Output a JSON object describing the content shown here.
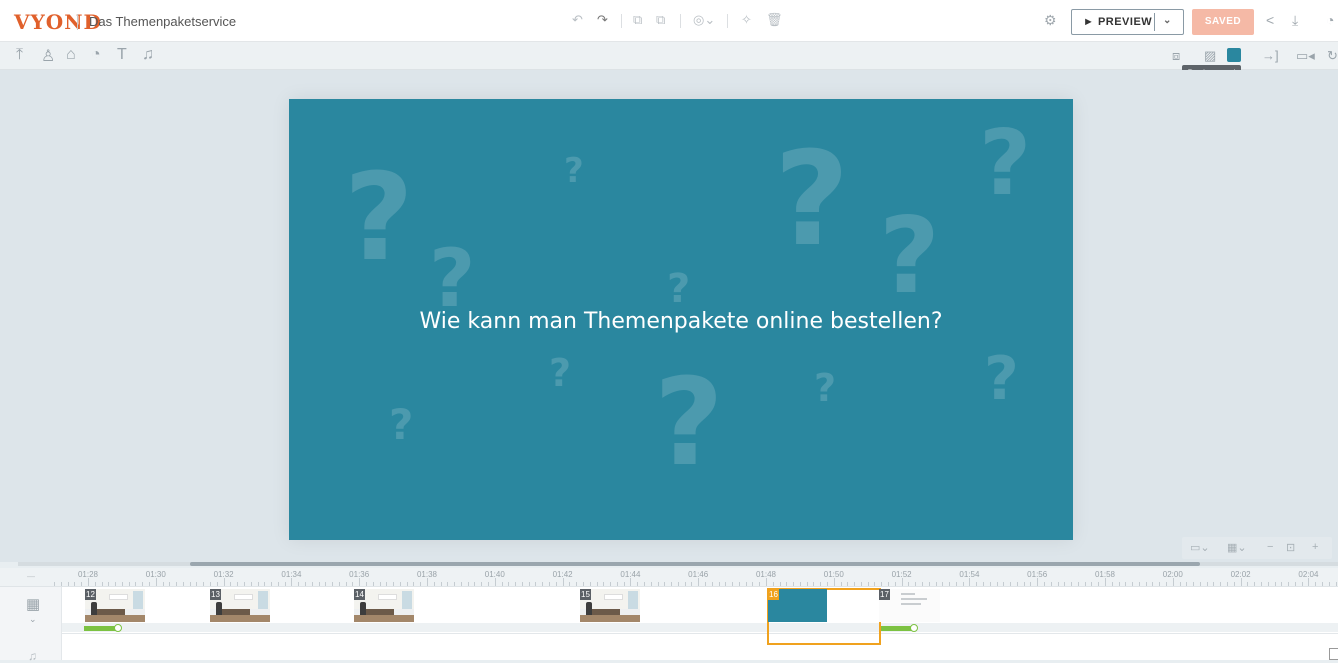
{
  "app": {
    "logo": "VYOND",
    "project_title": "Das Themenpaketservice"
  },
  "header": {
    "preview_label": "► PREVIEW",
    "preview_menu_icon": "chevron-down-icon",
    "saved_label": "SAVED",
    "icons": [
      "undo-icon",
      "redo-icon",
      "copy-icon",
      "paste-icon",
      "layers-icon",
      "effects-icon",
      "delete-icon",
      "settings-icon",
      "share-icon",
      "download-icon",
      "help-icon"
    ]
  },
  "toolbar": {
    "left_icons": [
      "upload-icon",
      "character-icon",
      "props-icon",
      "chart-icon",
      "text-icon",
      "music-icon"
    ],
    "right_icons": [
      "swap-template-icon",
      "background-image-icon",
      "background-color-swatch",
      "enter-exit-icon",
      "camera-icon",
      "rotate-icon"
    ],
    "background_color": "#2a879f",
    "tooltip": "Background"
  },
  "canvas": {
    "title": "Wie kann man Themenpakete online bestellen?",
    "background_color": "#2a879f"
  },
  "timeline": {
    "ruler_labels": [
      "01:28",
      "01:30",
      "01:32",
      "01:34",
      "01:36",
      "01:38",
      "01:40",
      "01:42",
      "01:44",
      "01:46",
      "01:48",
      "01:50",
      "01:52",
      "01:54",
      "01:56",
      "01:58",
      "02:00",
      "02:02",
      "02:04"
    ],
    "scenes": [
      {
        "number": "12",
        "kind": "office"
      },
      {
        "number": "13",
        "kind": "office"
      },
      {
        "number": "14",
        "kind": "office"
      },
      {
        "number": "15",
        "kind": "office"
      },
      {
        "number": "16",
        "kind": "title",
        "active": true
      },
      {
        "number": "17",
        "kind": "document"
      }
    ],
    "audio_level": 0.85
  }
}
